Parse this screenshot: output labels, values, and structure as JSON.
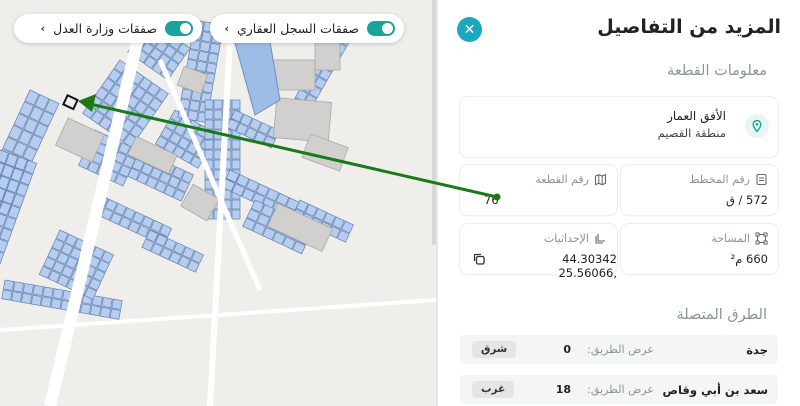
{
  "map": {
    "toggle_left_label": "صفقات وزارة العدل",
    "toggle_right_label": "صفقات السجل العقاري",
    "chevron": "›",
    "colors": {
      "parcel": "#b7cdef",
      "parcel_border": "#5f7fae",
      "block": "#d2d0cf",
      "water": "#9dbde6",
      "road": "#ffffff",
      "arrow": "#1a7a1a"
    }
  },
  "panel": {
    "title": "المزيد من التفاصيل",
    "close_icon": "✕",
    "plot_info_title": "معلومات القطعة",
    "location": {
      "name": "الأفق العمار",
      "region": "منطقة القصيم",
      "icon": "map-pin-icon"
    },
    "fields": {
      "plan_number": {
        "label": "رقم المخطط",
        "value": "572 / ق",
        "icon": "document-icon"
      },
      "plot_number": {
        "label": "رقم القطعة",
        "value": "76",
        "icon": "map-icon"
      },
      "area": {
        "label": "المساحة",
        "value": "660 م²",
        "icon": "area-icon"
      },
      "coordinates": {
        "label": "الإحداثيات",
        "value": "44.30342 ,25.56066",
        "icon": "crosshair-icon"
      }
    },
    "copy_icon": "copy-icon",
    "roads_title": "الطرق المتصلة",
    "roads": [
      {
        "name": "جدة",
        "width_label": "عرض الطريق:",
        "width_value": "0",
        "direction": "شرق"
      },
      {
        "name": "سعد بن أبي وقاص",
        "width_label": "عرض الطريق:",
        "width_value": "18",
        "direction": "غرب"
      }
    ],
    "accent_color": "#1ba8c0"
  }
}
